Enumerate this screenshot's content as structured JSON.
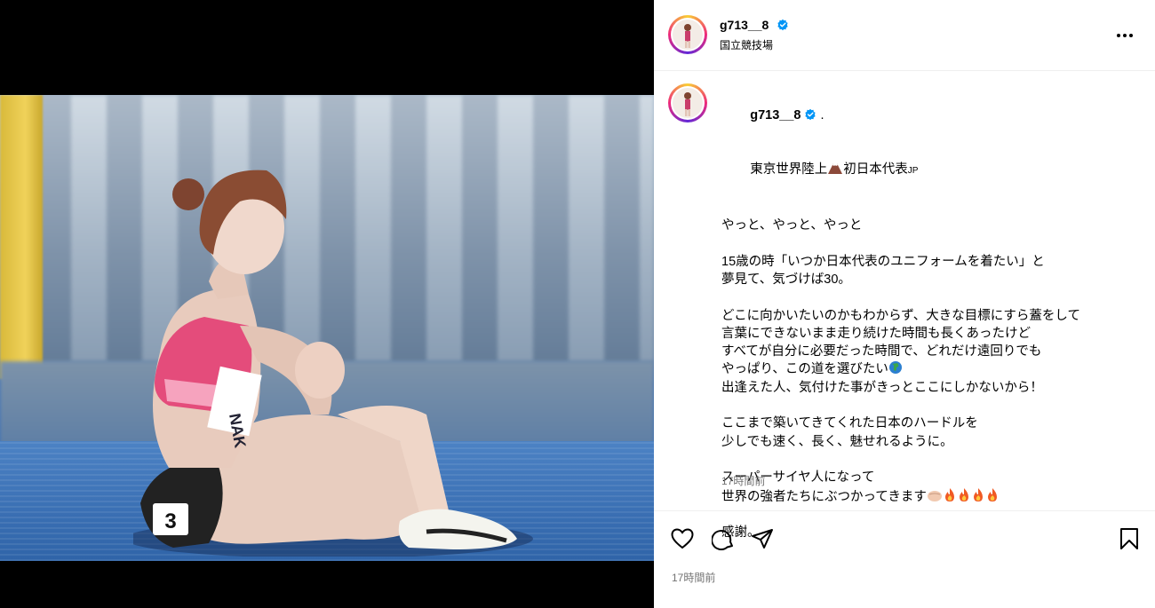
{
  "post": {
    "username": "g713__8",
    "location": "国立競技場",
    "caption_name": "g713__8",
    "caption_name_suffix": ".",
    "caption_line1_a": "東京世界陸上",
    "caption_line1_b": "初日本代表",
    "caption_line1_c": "JP",
    "caption_lines": [
      "やっと、やっと、やっと",
      "",
      "15歳の時「いつか日本代表のユニフォームを着たい」と",
      "夢見て、気づけば30。",
      "",
      "どこに向かいたいのかもわからず、大きな目標にすら蓋をして",
      "言葉にできないまま走り続けた時間も長くあったけど",
      "すべてが自分に必要だった時間で、どれだけ遠回りでも",
      "やっぱり、この道を選びたい",
      "出逢えた人、気付けた事がきっとここにしかないから！",
      "",
      "ここまで築いてきてくれた日本のハードルを",
      "少しでも速く、長く、魅せれるように。",
      "",
      "スーパーサイヤ人になって",
      "世界の強者たちにぶつかってきます",
      "",
      "感謝。"
    ],
    "caption_time": "17時間前",
    "bottom_time": "17時間前",
    "bib_number": "3",
    "bib_name": "NAK"
  },
  "icons": {
    "verified": "verified-badge-icon",
    "more": "more-options-icon",
    "like": "heart-icon",
    "comment": "comment-icon",
    "share": "share-icon",
    "save": "bookmark-icon"
  },
  "colors": {
    "verified": "#0095f6",
    "secondary_text": "#737373",
    "divider": "#efefef"
  }
}
